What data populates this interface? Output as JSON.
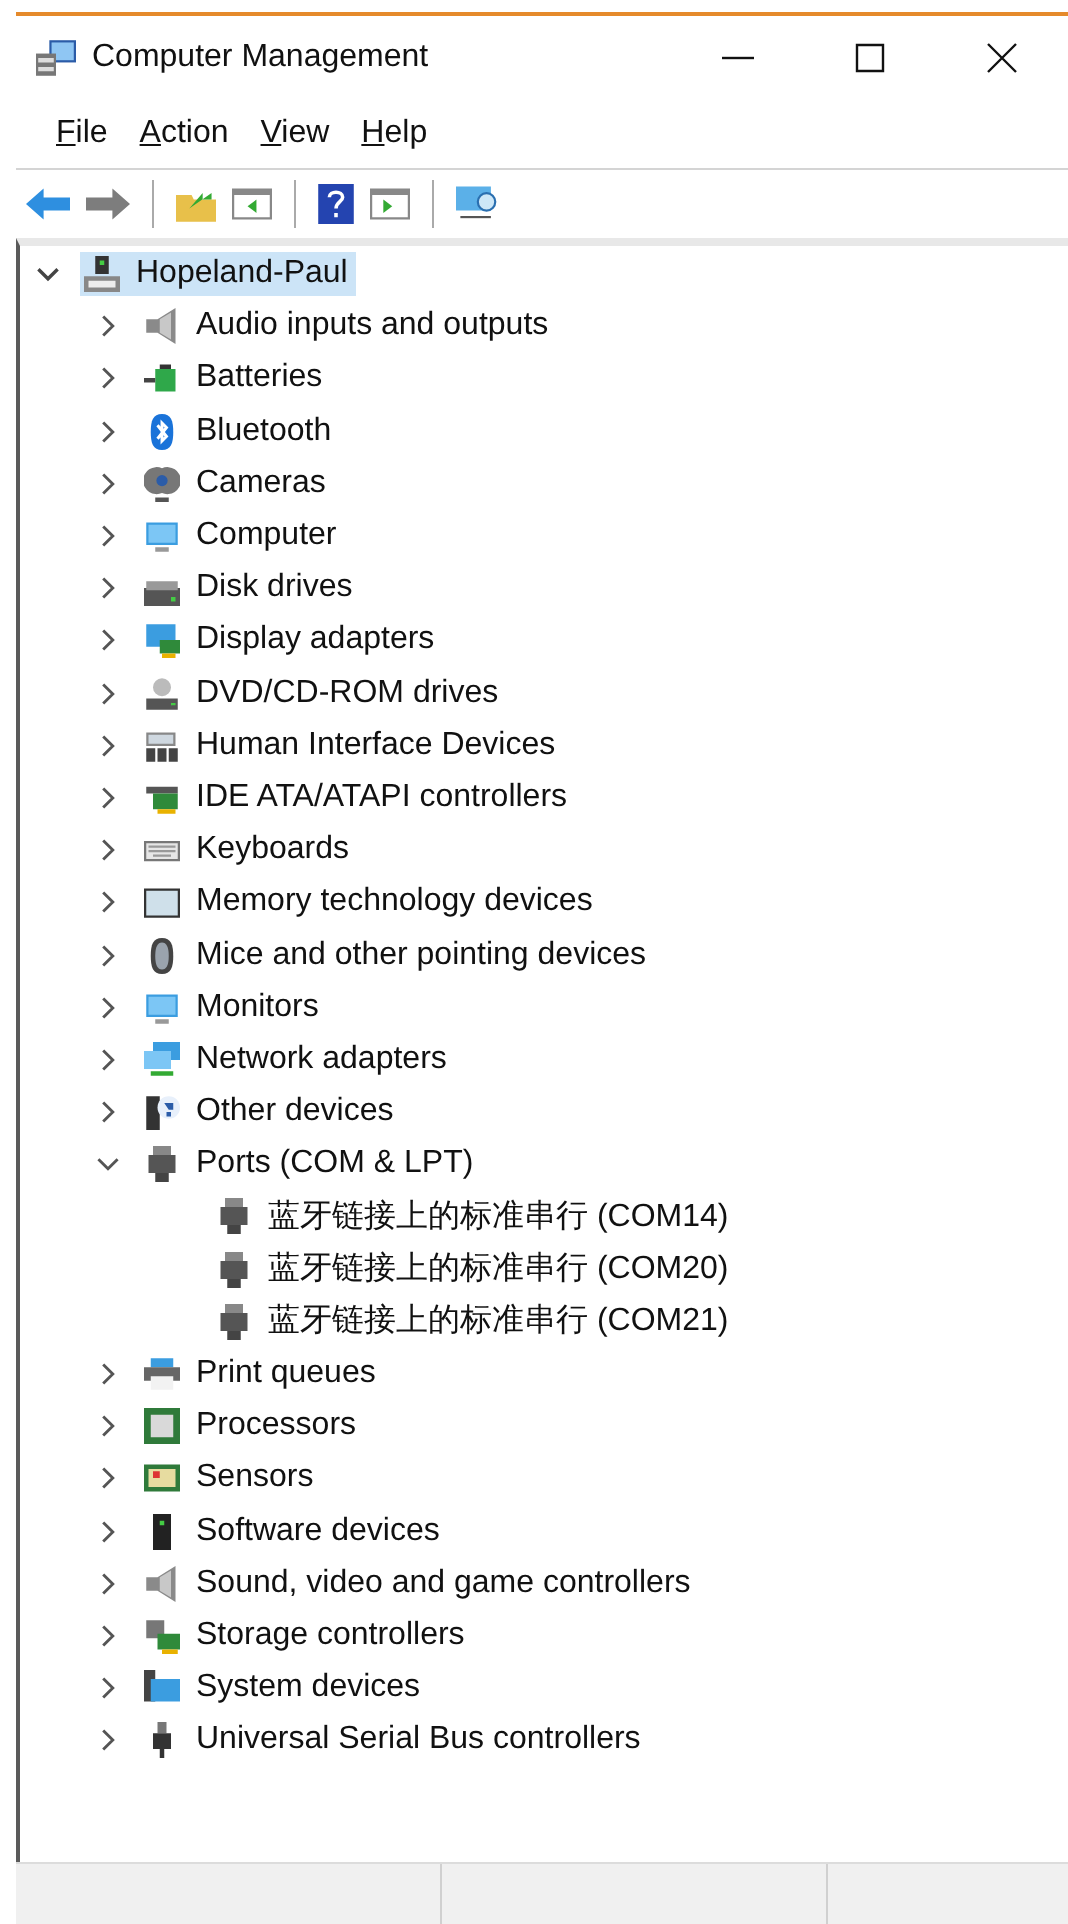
{
  "window": {
    "title": "Computer Management"
  },
  "menu": [
    "File",
    "Action",
    "View",
    "Help"
  ],
  "tree": {
    "label": "Hopeland-Paul",
    "expanded": true,
    "selected": true,
    "children": [
      {
        "label": "Audio inputs and outputs",
        "expanded": false,
        "selected": false
      },
      {
        "label": "Batteries",
        "expanded": false,
        "selected": false
      },
      {
        "label": "Bluetooth",
        "expanded": false,
        "selected": false
      },
      {
        "label": "Cameras",
        "expanded": false,
        "selected": false
      },
      {
        "label": "Computer",
        "expanded": false,
        "selected": false
      },
      {
        "label": "Disk drives",
        "expanded": false,
        "selected": false
      },
      {
        "label": "Display adapters",
        "expanded": false,
        "selected": false
      },
      {
        "label": "DVD/CD-ROM drives",
        "expanded": false,
        "selected": false
      },
      {
        "label": "Human Interface Devices",
        "expanded": false,
        "selected": false
      },
      {
        "label": "IDE ATA/ATAPI controllers",
        "expanded": false,
        "selected": false
      },
      {
        "label": "Keyboards",
        "expanded": false,
        "selected": false
      },
      {
        "label": "Memory technology devices",
        "expanded": false,
        "selected": false
      },
      {
        "label": "Mice and other pointing devices",
        "expanded": false,
        "selected": false
      },
      {
        "label": "Monitors",
        "expanded": false,
        "selected": false
      },
      {
        "label": "Network adapters",
        "expanded": false,
        "selected": false
      },
      {
        "label": "Other devices",
        "expanded": false,
        "selected": false
      },
      {
        "label": "Ports (COM & LPT)",
        "expanded": true,
        "selected": false,
        "children": [
          {
            "label": "蓝牙链接上的标准串行 (COM14)",
            "selected": false
          },
          {
            "label": "蓝牙链接上的标准串行 (COM20)",
            "selected": false
          },
          {
            "label": "蓝牙链接上的标准串行 (COM21)",
            "selected": false
          }
        ]
      },
      {
        "label": "Print queues",
        "expanded": false,
        "selected": false
      },
      {
        "label": "Processors",
        "expanded": false,
        "selected": false
      },
      {
        "label": "Sensors",
        "expanded": false,
        "selected": false
      },
      {
        "label": "Software devices",
        "expanded": false,
        "selected": false
      },
      {
        "label": "Sound, video and game controllers",
        "expanded": false,
        "selected": false
      },
      {
        "label": "Storage controllers",
        "expanded": false,
        "selected": false
      },
      {
        "label": "System devices",
        "expanded": false,
        "selected": false
      },
      {
        "label": "Universal Serial Bus controllers",
        "expanded": false,
        "selected": false
      }
    ]
  }
}
